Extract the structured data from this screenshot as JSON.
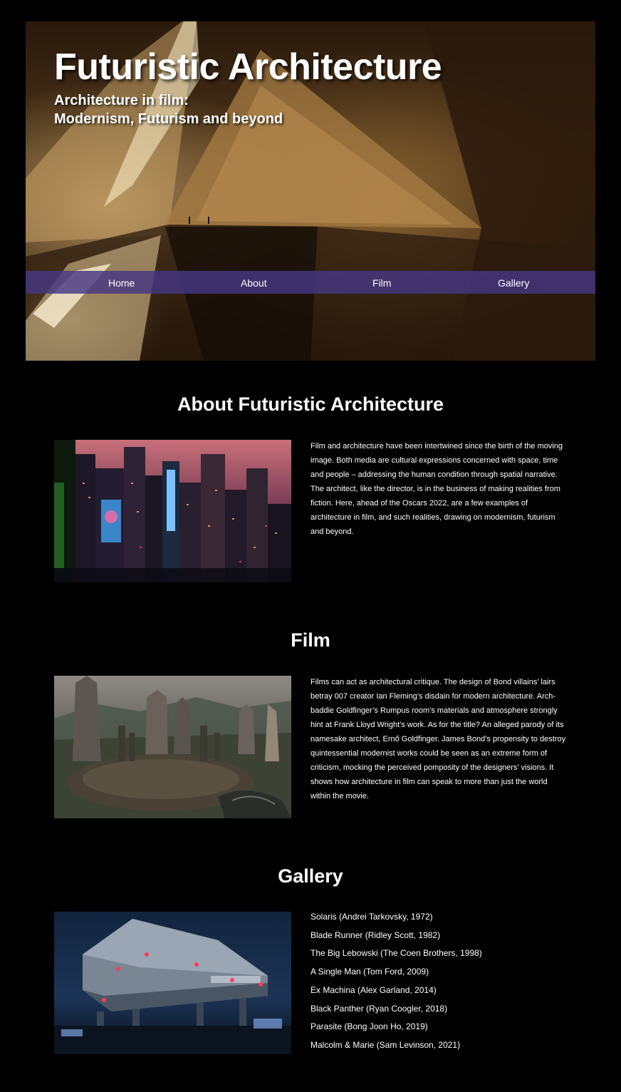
{
  "header": {
    "title": "Futuristic Architecture",
    "subtitle_line1": "Architecture in film:",
    "subtitle_line2": "Modernism, Futurism and beyond"
  },
  "nav": {
    "items": [
      {
        "label": "Home"
      },
      {
        "label": "About"
      },
      {
        "label": "Film"
      },
      {
        "label": "Gallery"
      }
    ]
  },
  "about": {
    "heading": "About Futuristic Architecture",
    "text": "Film and architecture have been intertwined since the birth of the moving image. Both media are cultural expressions concerned with space, time and people – addressing the human condition through spatial narrative. The architect, like the director, is in the business of making realities from fiction. Here, ahead of the Oscars 2022, are a few examples of architecture in film, and such realities, drawing on modernism, futurism and beyond."
  },
  "film": {
    "heading": "Film",
    "text": "Films can act as architectural critique. The design of Bond villains’ lairs betray 007 creator Ian Fleming’s disdain for modern architecture. Arch-baddie Goldfinger’s Rumpus room’s materials and atmosphere strongly hint at Frank Lloyd Wright’s work. As for the title? An alleged parody of its namesake architect, Ernő Goldfinger. James Bond’s propensity to destroy quintessential modernist works could be seen as an extreme form of criticism, mocking the perceived pomposity of the designers’ visions. It shows how architecture in film can speak to more than just the world within the movie."
  },
  "gallery": {
    "heading": "Gallery",
    "items": [
      "Solaris (Andrei Tarkovsky, 1972)",
      "Blade Runner (Ridley Scott, 1982)",
      "The Big Lebowski (The Coen Brothers, 1998)",
      "A Single Man (Tom Ford, 2009)",
      "Ex Machina (Alex Garland, 2014)",
      "Black Panther (Ryan Coogler, 2018)",
      "Parasite (Bong Joon Ho, 2019)",
      "Malcolm & Marie (Sam Levinson, 2021)"
    ]
  },
  "colors": {
    "background": "#000000",
    "nav_bar": "#463782",
    "text": "#ffffff"
  }
}
